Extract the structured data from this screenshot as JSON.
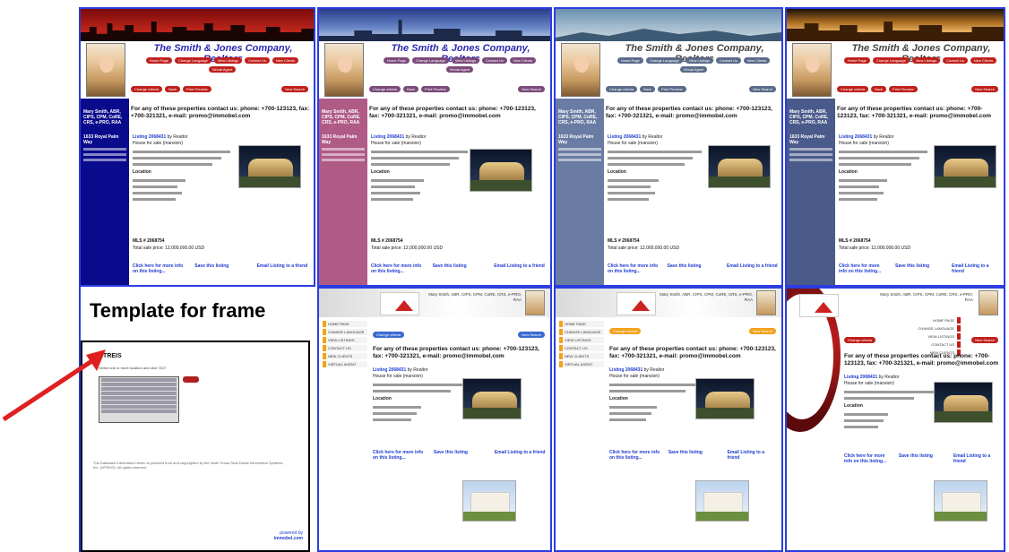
{
  "company_name": "The Smith & Jones Company, Realtors",
  "agent": {
    "name_lines": "Mary Smith, ABR, CIPS, CPM, CoRE, CRS, e-PRO, RAA",
    "address": "1633 Royal Palm Way"
  },
  "nav_buttons": [
    "Home Page",
    "Change Language",
    "View Listings",
    "Contact Us",
    "New Clients",
    "Virtual Agent"
  ],
  "listing_buttons": [
    "Change criteria",
    "Back",
    "Print Preview",
    "New Search"
  ],
  "contact_text_prefix": "For any of these properties contact us:",
  "contact_text": "phone: +700-123123, fax: +700-321321, e-mail: promo@immobel.com",
  "listing": {
    "title_link": "Listing 2068431",
    "title_by": "by Realtor",
    "for_sale": "House for sale (mansion)",
    "location_heading": "Location",
    "mls": "MLS # 2068754",
    "total_price": "Total sale price: 12,000,000.00 USD"
  },
  "footer_links": [
    "Click here for more info on this listing...",
    "Save this listing",
    "Email Listing to a friend"
  ],
  "template_title": "Template for frame",
  "template_panel": {
    "brand": "NTREIS",
    "select_label": "Select one or more location and click 'GO!'",
    "legal_text": "The Database Information herein is provided from and copyrighted by the North Texas Real Estate Information Systems, Inc. (NTREIS). All rights reserved.",
    "powered_by": "powered by",
    "powered_brand": "immobel.com"
  },
  "side_nav": [
    "HOME PAGE",
    "CHANGE LANGUAGE",
    "VIEW LISTINGS",
    "CONTACT US",
    "NEW CLIENTS",
    "VIRTUAL AGENT"
  ],
  "header_contact": "Mary Smith, ABR, CIPS, CPM, CoRE, CRS, e-PRO, RAA",
  "colors": {
    "frame_border": "#2b3de0",
    "sidebar_navy": "#0a0a8c",
    "sidebar_mauve": "#b05a86",
    "sidebar_slate": "#6a7ca4",
    "sidebar_steel": "#4a5a8a",
    "arrow": "#e02020",
    "pill_red": "#c0201c",
    "pill_mauve": "#7a4a7a",
    "pill_slate": "#5a6a8a",
    "nav_orange": "#f3a21d"
  }
}
